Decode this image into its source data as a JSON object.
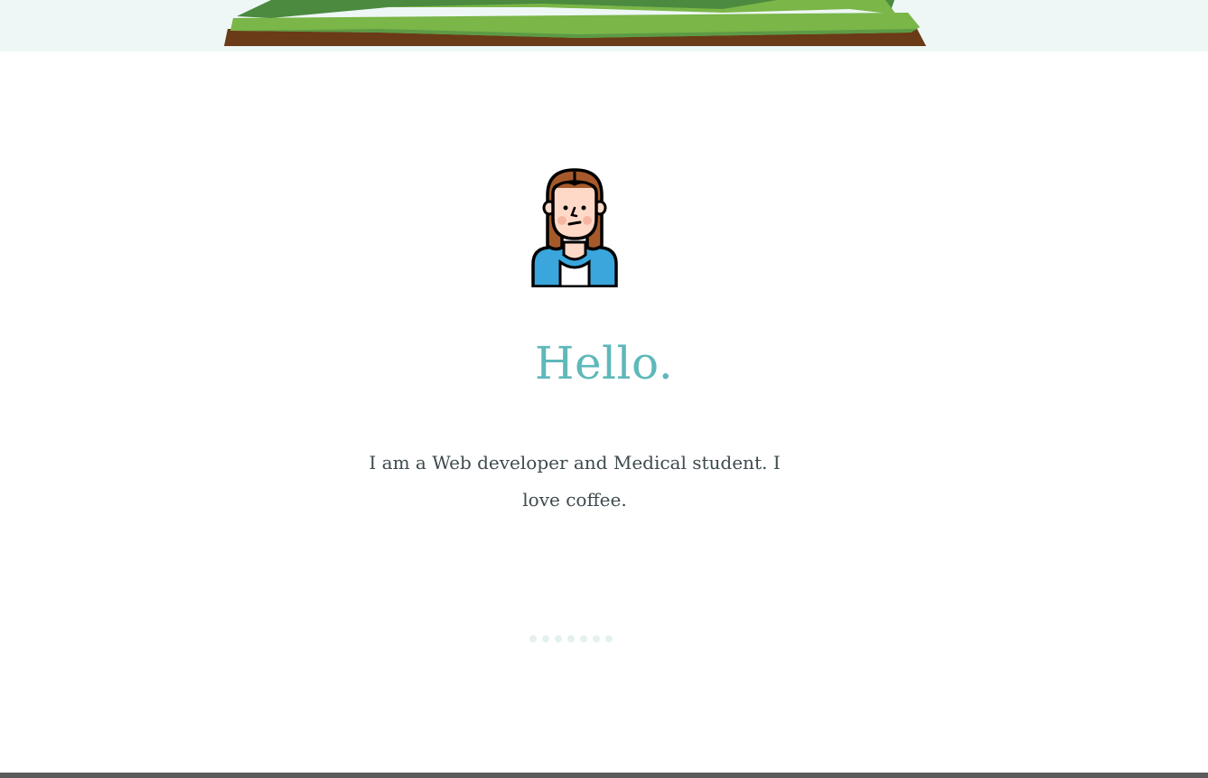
{
  "hero": {
    "title": "Hello.",
    "intro": "I am a Web developer and Medical student. I love coffee."
  },
  "illustrations": {
    "header": "floating-island-illustration",
    "avatar": "woman-avatar-illustration"
  },
  "pagination": {
    "dot_count": 7,
    "active_index": null
  },
  "colors": {
    "accent": "#5fb8b9",
    "text": "#3e4a4e",
    "top_band": "#eef7f6",
    "grass_dark": "#4b8a3f",
    "grass_light": "#7ab648",
    "soil": "#6b3a17",
    "dot": "#e4f1f0",
    "footer_bar": "#5b5b5b"
  }
}
